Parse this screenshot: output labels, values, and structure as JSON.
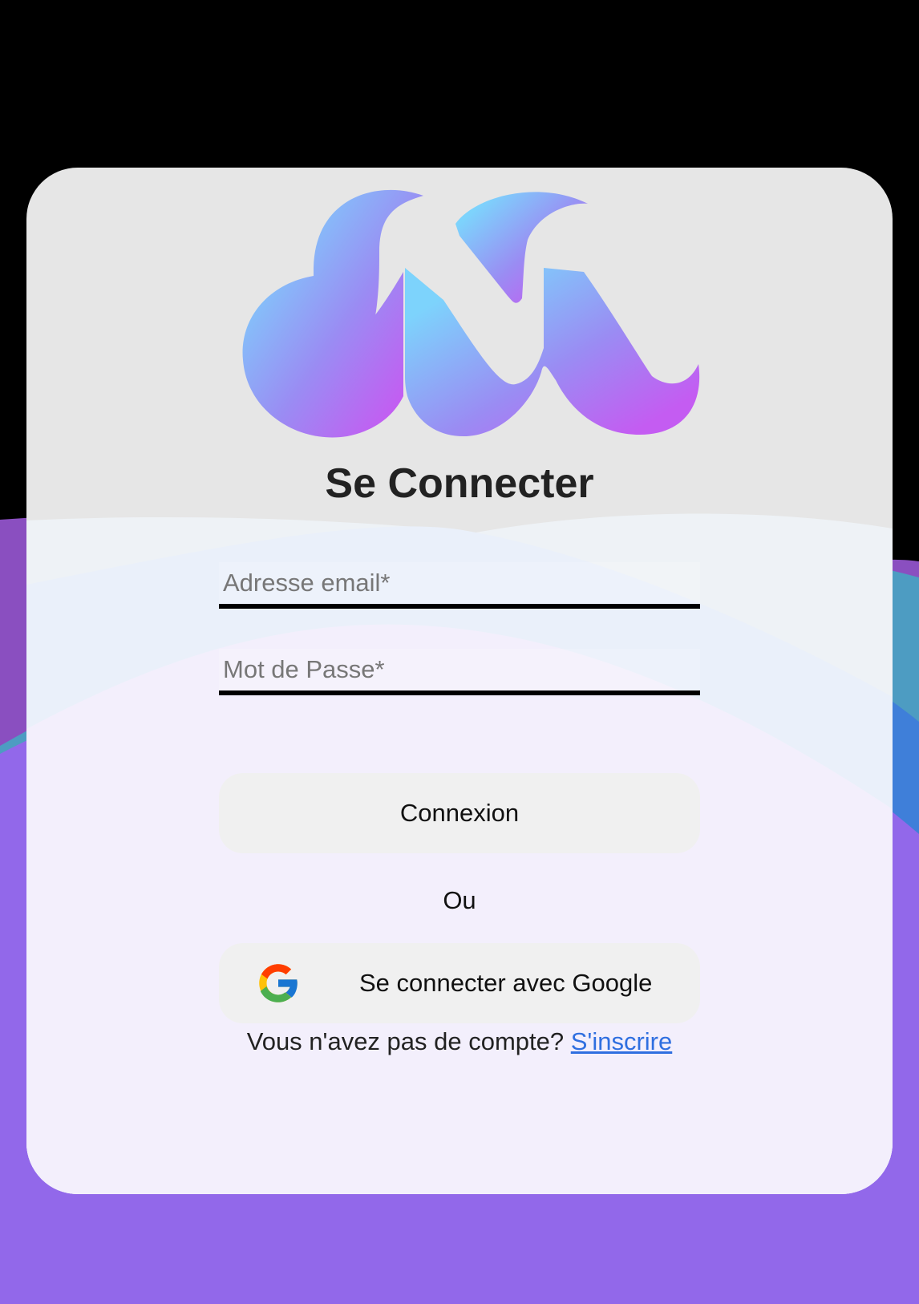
{
  "login": {
    "title": "Se Connecter",
    "email_placeholder": "Adresse email*",
    "password_placeholder": "Mot de Passe*",
    "submit_label": "Connexion",
    "or_label": "Ou",
    "google_label": "Se connecter avec Google",
    "no_account_text": "Vous n'avez pas de compte? ",
    "signup_link": "S'inscrire"
  },
  "icons": {
    "logo": "brand-logo",
    "google": "google-icon"
  },
  "colors": {
    "background_top": "#000000",
    "background_purple": "#9268ea",
    "card_top": "#e6e6e6",
    "card_bottom": "#f3effc",
    "logo_gradient_start": "#7dd3fc",
    "logo_gradient_end": "#c45cf2",
    "link": "#2f6fe0",
    "button_bg": "#f0f0f0"
  }
}
